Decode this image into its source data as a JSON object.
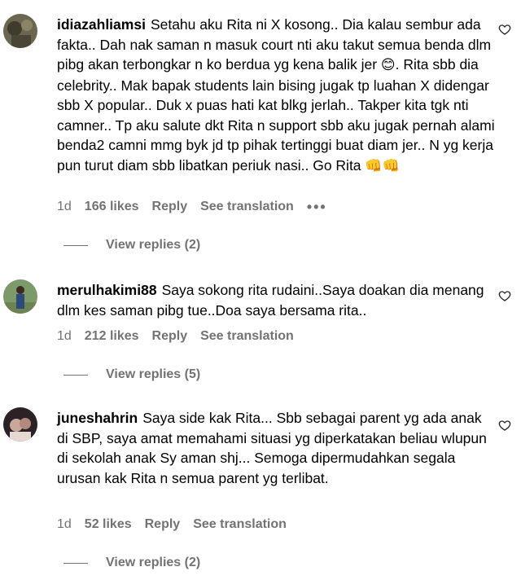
{
  "comments": [
    {
      "username": "idiazahliamsi",
      "text": "Setahu aku Rita ni X kosong.. Dia kalau sembur ada fakta.. Dah nak saman n masuk court nti aku takut semua benda dlm pibg akan terbongkar n ko berdua yg kena balik jer",
      "emoji1": "😊",
      "text2": ". Rita sbb dia celebrity.. Mak bapak students lain bising jugak tp luahan X didengar sbb X popular.. Duk x puas hati kat blkg jerlah.. Takper kita tgk nti camner.. Tp aku salute dkt Rita n support sbb aku jugak pernah alami benda2 camni mmg byk jd tp pihak tertinggi buat diam jer.. N yg kerja pun turut diam sbb libatkan periuk nasi.. Go Rita",
      "emoji2": "👊👊",
      "time": "1d",
      "likes": "166 likes",
      "reply": "Reply",
      "translate": "See translation",
      "more": "•••",
      "view_replies": "View replies (2)"
    },
    {
      "username": "merulhakimi88",
      "text": "Saya sokong rita rudaini..Saya doakan dia menang dlm kes saman pibg tue..Doa saya bersama rita..",
      "time": "1d",
      "likes": "212 likes",
      "reply": "Reply",
      "translate": "See translation",
      "view_replies": "View replies (5)"
    },
    {
      "username": "juneshahrin",
      "text": "Saya side kak Rita... Sbb sebagai parent yg ada anak di SBP, saya amat memahami situasi yg diperkatakan beliau wlupun di sekolah anak Sy aman shj... Semoga dipermudahkan segala urusan kak Rita n semua parent yg terlibat.",
      "time": "1d",
      "likes": "52 likes",
      "reply": "Reply",
      "translate": "See translation",
      "view_replies": "View replies (2)"
    }
  ],
  "icons": {
    "like": "heart-outline-icon",
    "more": "more-dots-icon"
  },
  "colors": {
    "meta": "#737373",
    "text": "#000000"
  }
}
